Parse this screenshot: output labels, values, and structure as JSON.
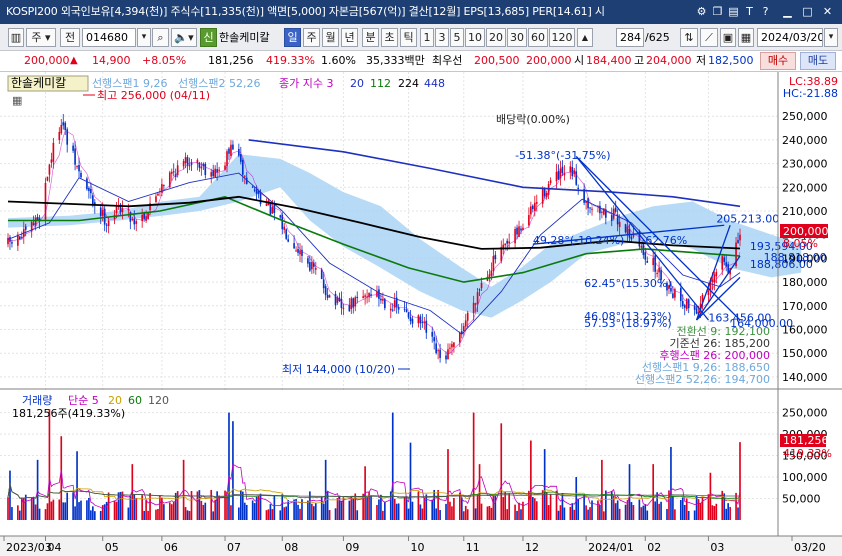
{
  "titlebar": {
    "title": "KOSPI200 외국인보유[4,394(천)] 주식수[11,335(천)] 액면[5,000] 자본금[567(억)] 결산[12월] EPS[13,685] PER[14.61] 시",
    "icons": [
      "settings-icon",
      "copy-icon",
      "print-icon",
      "text-icon",
      "help-icon",
      "minimize-icon",
      "maximize-icon",
      "close-icon"
    ]
  },
  "toolbar": {
    "type_label": "주",
    "prev_label": "전",
    "code": "014680",
    "stock_name": "한솔케미칼",
    "badge": "신",
    "periods": [
      "일",
      "주",
      "월",
      "년",
      "분",
      "초",
      "틱"
    ],
    "active_period": "일",
    "minutes": [
      "1",
      "3",
      "5",
      "10",
      "20",
      "30",
      "60",
      "120"
    ],
    "range": "284",
    "total": "/625",
    "date": "2024/03/20"
  },
  "quote": {
    "price": "200,000",
    "change": "14,900",
    "change_pct": "+8.05%",
    "volume": "181,256",
    "volume_pct": "419.33%",
    "turnover_pct": "1.60%",
    "amount": "35,333백만",
    "pref_label": "최우선",
    "ask": "200,500",
    "bid": "200,000",
    "open_label": "시",
    "open": "184,400",
    "high_label": "고",
    "high": "204,000",
    "low_label": "저",
    "low": "182,500",
    "buy_label": "매수",
    "sell_label": "매도"
  },
  "price_panel": {
    "name": "한솔케미칼",
    "legend": [
      {
        "text": "선행스팬1 9,26",
        "color": "#6fa8dc"
      },
      {
        "text": "선행스팬2 52,26",
        "color": "#6fa8dc"
      },
      {
        "text": "종가 지수 3",
        "color": "#c000c0"
      },
      {
        "text": "20",
        "color": "#1e30c0"
      },
      {
        "text": "112",
        "color": "#0a7a0a"
      },
      {
        "text": "224",
        "color": "#000000"
      },
      {
        "text": "448",
        "color": "#1e30c0"
      }
    ],
    "lc": "LC:38.89",
    "hc": "HC:-21.88",
    "high_marker": "최고 256,000 (04/11)",
    "low_marker": "최저 144,000 (10/20)",
    "dividend": "배당락(0.00%)",
    "price_tag": "200,000",
    "price_tag_pct": "8.05%",
    "annotations": [
      {
        "text": "-51.38°(-31.75%)",
        "value": 232000,
        "date": "2023-11-27",
        "color": "#0032c8"
      },
      {
        "text": "205,213.00",
        "value": 205213,
        "date": "2024-03-08",
        "color": "#0032c8"
      },
      {
        "text": "49.28°(-10.24%)",
        "value": 196000,
        "date": "2023-12-06",
        "color": "#0032c8"
      },
      {
        "text": "-62.76%",
        "value": 196000,
        "date": "2024-01-30",
        "color": "#0032c8"
      },
      {
        "text": "193,594.00",
        "value": 193594,
        "date": "2024-03-25",
        "color": "#0032c8"
      },
      {
        "text": "188,818.00",
        "value": 188818,
        "date": "2024-04-01",
        "color": "#0032c8"
      },
      {
        "text": "188,806.00",
        "value": 186000,
        "date": "2024-03-25",
        "color": "#0032c8"
      },
      {
        "text": "62.45°(15.30%)",
        "value": 178000,
        "date": "2024-01-01",
        "color": "#0032c8"
      },
      {
        "text": "46.08°(13.23%)",
        "value": 164000,
        "date": "2024-01-01",
        "color": "#0032c8"
      },
      {
        "text": "57.53°(18.97%)",
        "value": 161000,
        "date": "2024-01-01",
        "color": "#0032c8"
      },
      {
        "text": "163,456.00",
        "value": 163456,
        "date": "2024-03-04",
        "color": "#0032c8"
      },
      {
        "text": "164,000.00",
        "value": 161000,
        "date": "2024-03-15",
        "color": "#0032c8"
      }
    ],
    "ichimoku_labels": [
      {
        "text": "전환선 9: 192,100",
        "color": "#3f8f3f"
      },
      {
        "text": "기준선 26: 185,200",
        "color": "#333333"
      },
      {
        "text": "후행스팬 26: 200,000",
        "color": "#c000c0"
      },
      {
        "text": "선행스팬1 9,26: 188,650",
        "color": "#6fa8dc"
      },
      {
        "text": "선행스팬2 52,26: 194,700",
        "color": "#6fa8dc"
      }
    ]
  },
  "volume_panel": {
    "legend": [
      {
        "text": "거래량",
        "color": "#0032c8"
      },
      {
        "text": "단순 5",
        "color": "#c000c0"
      },
      {
        "text": "20",
        "color": "#c8a000"
      },
      {
        "text": "60",
        "color": "#0a7a0a"
      },
      {
        "text": "120",
        "color": "#555555"
      }
    ],
    "current": "181,256주(419.33%)",
    "tag": "181,256",
    "tag_pct": "419.33%"
  },
  "colors": {
    "up": "#e0001b",
    "down": "#0032c8",
    "cloud": "#aad3f5",
    "axis_bg": "#ffffff",
    "titlebar": "#1e3f73"
  },
  "chart_data": [
    {
      "type": "candlestick",
      "title": "한솔케미칼",
      "x_start": "2023-03-15",
      "x_end": "2024-03-20",
      "ylim": [
        137000,
        256000
      ],
      "y_ticks": [
        140000,
        150000,
        160000,
        170000,
        180000,
        190000,
        200000,
        210000,
        220000,
        230000,
        240000,
        250000
      ],
      "x_ticks": [
        "2023/03",
        "04",
        "05",
        "06",
        "07",
        "08",
        "09",
        "10",
        "11",
        "12",
        "2024/01",
        "02",
        "03",
        "03/20"
      ],
      "x_tick_dates": [
        "2023-03-02",
        "2023-04-03",
        "2023-05-02",
        "2023-06-01",
        "2023-07-03",
        "2023-08-01",
        "2023-09-01",
        "2023-10-04",
        "2023-11-01",
        "2023-12-01",
        "2024-01-02",
        "2024-02-01",
        "2024-03-04",
        "2024-04-20"
      ],
      "close_path": [
        [
          "2023-03-15",
          196000
        ],
        [
          "2023-03-24",
          200000
        ],
        [
          "2023-03-31",
          208000
        ],
        [
          "2023-04-05",
          230000
        ],
        [
          "2023-04-11",
          249000
        ],
        [
          "2023-04-14",
          239000
        ],
        [
          "2023-04-20",
          226000
        ],
        [
          "2023-04-27",
          214000
        ],
        [
          "2023-05-04",
          206000
        ],
        [
          "2023-05-11",
          212000
        ],
        [
          "2023-05-18",
          206000
        ],
        [
          "2023-05-25",
          210000
        ],
        [
          "2023-06-01",
          222000
        ],
        [
          "2023-06-09",
          228000
        ],
        [
          "2023-06-16",
          232000
        ],
        [
          "2023-06-23",
          228000
        ],
        [
          "2023-06-30",
          226000
        ],
        [
          "2023-07-07",
          238000
        ],
        [
          "2023-07-14",
          222000
        ],
        [
          "2023-07-21",
          216000
        ],
        [
          "2023-07-28",
          208000
        ],
        [
          "2023-08-04",
          200000
        ],
        [
          "2023-08-11",
          192000
        ],
        [
          "2023-08-18",
          184000
        ],
        [
          "2023-08-25",
          174000
        ],
        [
          "2023-09-01",
          168000
        ],
        [
          "2023-09-08",
          172000
        ],
        [
          "2023-09-15",
          176000
        ],
        [
          "2023-09-22",
          172000
        ],
        [
          "2023-10-04",
          166000
        ],
        [
          "2023-10-11",
          162000
        ],
        [
          "2023-10-16",
          154000
        ],
        [
          "2023-10-20",
          147000
        ],
        [
          "2023-10-27",
          152000
        ],
        [
          "2023-11-03",
          166000
        ],
        [
          "2023-11-10",
          180000
        ],
        [
          "2023-11-17",
          190000
        ],
        [
          "2023-11-24",
          196000
        ],
        [
          "2023-12-01",
          204000
        ],
        [
          "2023-12-08",
          214000
        ],
        [
          "2023-12-15",
          222000
        ],
        [
          "2023-12-20",
          225000
        ],
        [
          "2023-12-26",
          226000
        ],
        [
          "2024-01-02",
          214000
        ],
        [
          "2024-01-09",
          210000
        ],
        [
          "2024-01-16",
          208000
        ],
        [
          "2024-01-23",
          202000
        ],
        [
          "2024-01-30",
          194000
        ],
        [
          "2024-02-06",
          186000
        ],
        [
          "2024-02-13",
          178000
        ],
        [
          "2024-02-20",
          172000
        ],
        [
          "2024-02-27",
          168000
        ],
        [
          "2024-03-04",
          176000
        ],
        [
          "2024-03-11",
          190000
        ],
        [
          "2024-03-15",
          185100
        ],
        [
          "2024-03-20",
          200000
        ]
      ],
      "ma20": [
        [
          "2023-03-15",
          198000
        ],
        [
          "2023-04-05",
          205000
        ],
        [
          "2023-04-20",
          224000
        ],
        [
          "2023-05-15",
          214000
        ],
        [
          "2023-06-15",
          222000
        ],
        [
          "2023-07-10",
          226000
        ],
        [
          "2023-08-01",
          210000
        ],
        [
          "2023-08-25",
          188000
        ],
        [
          "2023-09-20",
          175000
        ],
        [
          "2023-10-15",
          168000
        ],
        [
          "2023-10-31",
          158000
        ],
        [
          "2023-11-20",
          176000
        ],
        [
          "2023-12-10",
          200000
        ],
        [
          "2023-12-31",
          215000
        ],
        [
          "2024-01-25",
          205000
        ],
        [
          "2024-02-20",
          183000
        ],
        [
          "2024-03-10",
          178000
        ],
        [
          "2024-03-20",
          184000
        ]
      ],
      "ma112": [
        [
          "2023-03-15",
          206000
        ],
        [
          "2023-04-20",
          206000
        ],
        [
          "2023-05-31",
          210000
        ],
        [
          "2023-07-03",
          216000
        ],
        [
          "2023-08-01",
          206000
        ],
        [
          "2023-09-01",
          196000
        ],
        [
          "2023-10-04",
          186000
        ],
        [
          "2023-11-01",
          180000
        ],
        [
          "2023-12-01",
          184000
        ],
        [
          "2024-01-02",
          192000
        ],
        [
          "2024-02-01",
          194000
        ],
        [
          "2024-03-04",
          192000
        ],
        [
          "2024-03-20",
          191000
        ]
      ],
      "ma224": [
        [
          "2023-03-15",
          214000
        ],
        [
          "2023-04-15",
          213000
        ],
        [
          "2023-05-15",
          212000
        ],
        [
          "2023-06-15",
          213500
        ],
        [
          "2023-07-10",
          216000
        ],
        [
          "2023-08-10",
          211000
        ],
        [
          "2023-09-10",
          205000
        ],
        [
          "2023-10-10",
          199000
        ],
        [
          "2023-11-10",
          194000
        ],
        [
          "2023-12-10",
          194500
        ],
        [
          "2024-01-15",
          197500
        ],
        [
          "2024-02-15",
          195500
        ],
        [
          "2024-03-20",
          194200
        ]
      ],
      "ma448": [
        [
          "2023-07-15",
          240000
        ],
        [
          "2023-09-01",
          235000
        ],
        [
          "2023-10-15",
          228000
        ],
        [
          "2023-12-01",
          220000
        ],
        [
          "2024-01-15",
          218000
        ],
        [
          "2024-02-15",
          216000
        ],
        [
          "2024-03-20",
          212000
        ]
      ],
      "cloud": [
        [
          "2023-03-15",
          207000,
          203000
        ],
        [
          "2023-04-15",
          208000,
          204000
        ],
        [
          "2023-05-10",
          210000,
          206000
        ],
        [
          "2023-06-01",
          214000,
          208000
        ],
        [
          "2023-06-20",
          216000,
          210000
        ],
        [
          "2023-07-10",
          234000,
          214000
        ],
        [
          "2023-07-31",
          232000,
          220000
        ],
        [
          "2023-08-15",
          226000,
          206000
        ],
        [
          "2023-09-01",
          218000,
          195000
        ],
        [
          "2023-09-20",
          212000,
          186000
        ],
        [
          "2023-10-10",
          198000,
          176000
        ],
        [
          "2023-10-31",
          186000,
          168000
        ],
        [
          "2023-11-15",
          178000,
          165000
        ],
        [
          "2023-11-30",
          186000,
          172000
        ],
        [
          "2023-12-15",
          196000,
          180000
        ],
        [
          "2024-01-02",
          202000,
          192000
        ],
        [
          "2024-01-20",
          208000,
          196000
        ],
        [
          "2024-02-05",
          212000,
          198000
        ],
        [
          "2024-02-25",
          214000,
          194000
        ],
        [
          "2024-03-15",
          206000,
          186000
        ],
        [
          "2024-04-05",
          200000,
          182000
        ],
        [
          "2024-04-20",
          196000,
          184000
        ]
      ],
      "trendlines": [
        {
          "from": [
            "2023-12-28",
            233000
          ],
          "to": [
            "2024-03-20",
            164000
          ],
          "color": "#0032c8"
        },
        {
          "from": [
            "2023-12-28",
            233000
          ],
          "to": [
            "2024-03-04",
            164000
          ],
          "color": "#0032c8"
        },
        {
          "from": [
            "2023-12-06",
            196000
          ],
          "to": [
            "2024-03-12",
            204000
          ],
          "color": "#0032c8"
        },
        {
          "from": [
            "2024-02-27",
            164000
          ],
          "to": [
            "2024-03-15",
            204000
          ],
          "color": "#0032c8"
        },
        {
          "from": [
            "2024-02-27",
            164000
          ],
          "to": [
            "2024-03-20",
            191000
          ],
          "color": "#0032c8"
        },
        {
          "from": [
            "2024-02-27",
            164000
          ],
          "to": [
            "2024-03-20",
            182000
          ],
          "color": "#0032c8"
        }
      ]
    },
    {
      "type": "bar",
      "title": "거래량",
      "x_start": "2023-03-15",
      "x_end": "2024-03-20",
      "ylim": [
        0,
        270000
      ],
      "y_ticks": [
        50000,
        100000,
        150000,
        200000,
        250000
      ],
      "spikes": [
        [
          "2023-03-16",
          115000
        ],
        [
          "2023-03-30",
          140000
        ],
        [
          "2023-04-05",
          258000
        ],
        [
          "2023-04-11",
          195000
        ],
        [
          "2023-04-19",
          160000
        ],
        [
          "2023-05-17",
          130000
        ],
        [
          "2023-06-12",
          140000
        ],
        [
          "2023-07-05",
          250000
        ],
        [
          "2023-07-07",
          230000
        ],
        [
          "2023-08-23",
          140000
        ],
        [
          "2023-09-12",
          125000
        ],
        [
          "2023-09-26",
          250000
        ],
        [
          "2023-10-05",
          180000
        ],
        [
          "2023-10-24",
          165000
        ],
        [
          "2023-11-06",
          250000
        ],
        [
          "2023-11-09",
          130000
        ],
        [
          "2023-11-20",
          225000
        ],
        [
          "2023-12-05",
          185000
        ],
        [
          "2023-12-12",
          165000
        ],
        [
          "2023-12-28",
          100000
        ],
        [
          "2024-01-10",
          140000
        ],
        [
          "2024-01-24",
          130000
        ],
        [
          "2024-02-05",
          130000
        ],
        [
          "2024-02-14",
          170000
        ],
        [
          "2024-03-05",
          110000
        ],
        [
          "2024-03-20",
          181256
        ]
      ]
    }
  ]
}
